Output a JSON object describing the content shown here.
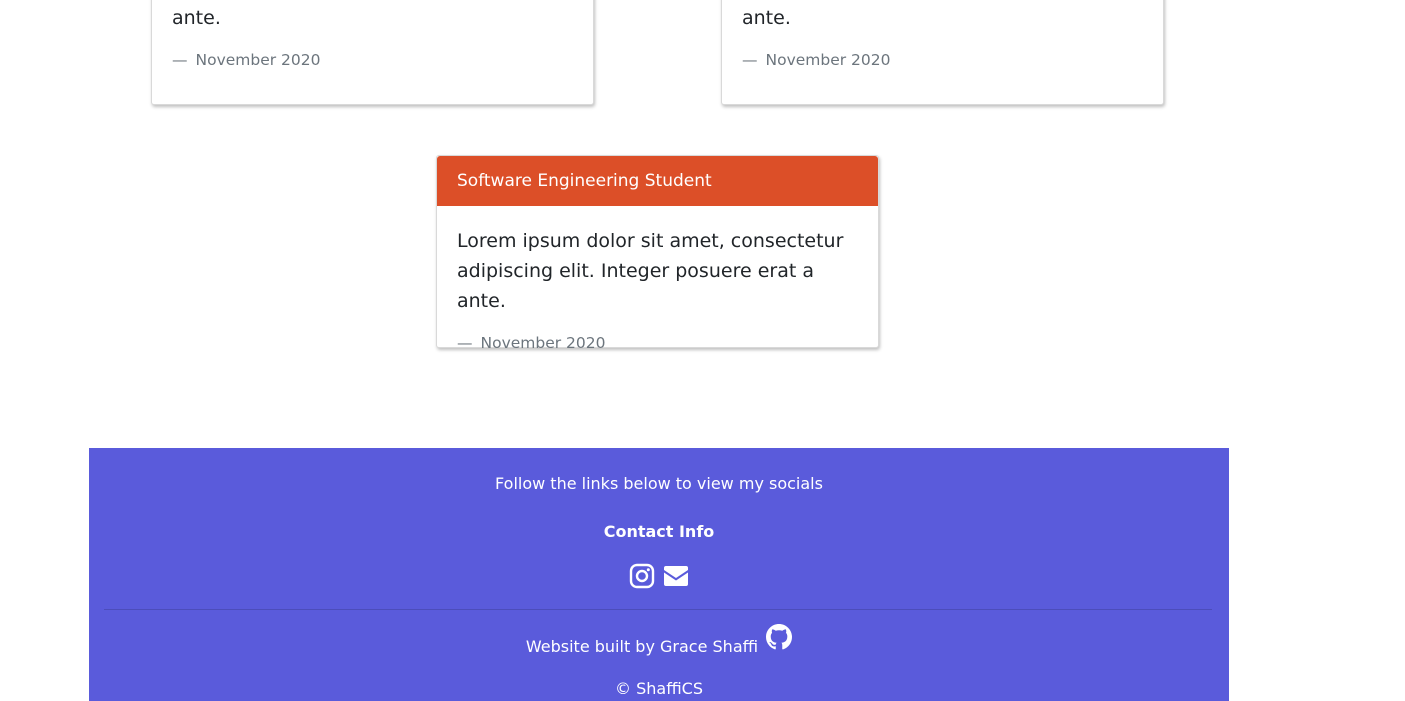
{
  "cards": [
    {
      "title": "",
      "text": "Lorem ipsum dolor sit amet, consectetur adipiscing elit. Integer posuere erat a ante.",
      "dash": "—",
      "date": "November 2020"
    },
    {
      "title": "",
      "text": "Lorem ipsum dolor sit amet, consectetur adipiscing elit. Integer posuere erat a ante.",
      "dash": "—",
      "date": "November 2020"
    },
    {
      "title": "Software Engineering Student",
      "text": "Lorem ipsum dolor sit amet, consectetur adipiscing elit. Integer posuere erat a ante.",
      "dash": "—",
      "date": "November 2020"
    }
  ],
  "footer": {
    "follow_text": "Follow the links below to view my socials",
    "contact_heading": "Contact Info",
    "icons": [
      "instagram-icon",
      "envelope-icon",
      "github-icon"
    ],
    "built_by": "Website built by Grace Shaffi",
    "copyright": "© ShaffiCS"
  },
  "colors": {
    "card_header": "#dc4f28",
    "footer_bg": "#5a5bdb",
    "muted_text": "#6c757d"
  }
}
